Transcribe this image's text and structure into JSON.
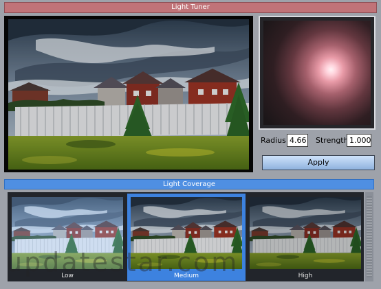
{
  "window": {
    "title": "Light Tuner"
  },
  "controls": {
    "radius_label": "Radius",
    "radius_value": "4.66",
    "strength_label": "Strength",
    "strength_value": "1.000",
    "apply_label": "Apply"
  },
  "coverage": {
    "title": "Light Coverage",
    "options": [
      {
        "label": "Low",
        "selected": false
      },
      {
        "label": "Medium",
        "selected": true
      },
      {
        "label": "High",
        "selected": false
      }
    ]
  },
  "watermark": "updatestar.com",
  "colors": {
    "title_bar": "#c07378",
    "section_bar": "#4f8fe2",
    "selected": "#3d82df",
    "window_bg": "#9ea2aa"
  }
}
